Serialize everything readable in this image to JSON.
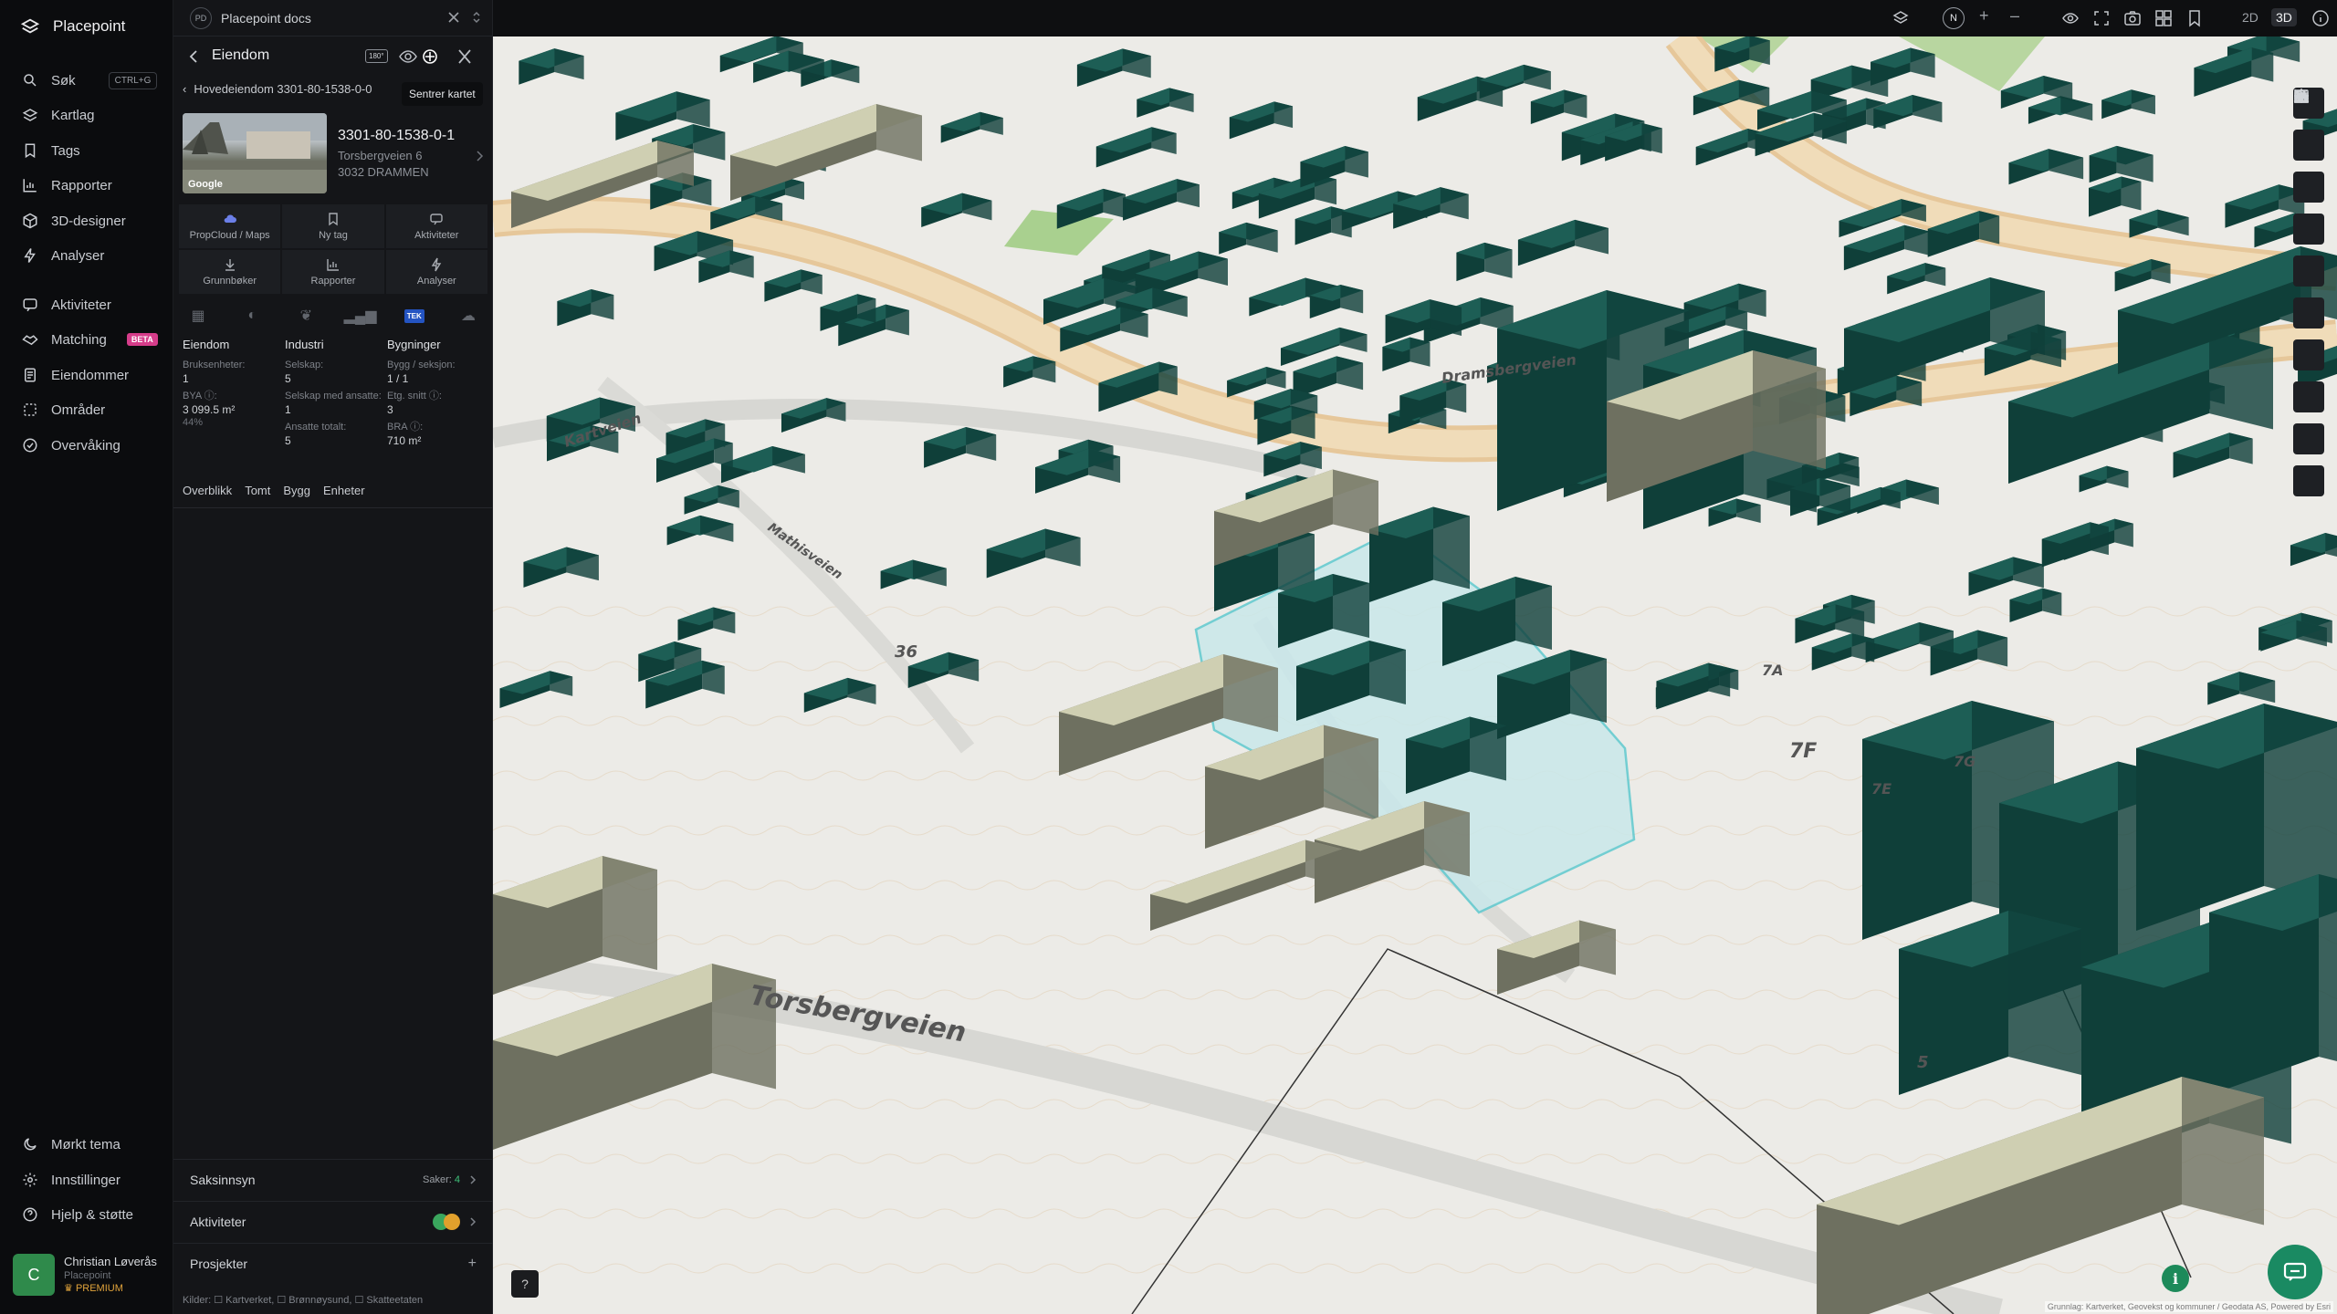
{
  "app": {
    "name": "Placepoint"
  },
  "nav": {
    "search": {
      "label": "Søk",
      "shortcut": "CTRL+G"
    },
    "items_top": [
      "Kartlag",
      "Tags",
      "Rapporter",
      "3D-designer",
      "Analyser"
    ],
    "items_mid": [
      "Aktiviteter",
      "Matching",
      "Eiendommer",
      "Områder",
      "Overvåking"
    ],
    "beta": "BETA",
    "items_bottom": [
      "Mørkt tema",
      "Innstillinger",
      "Hjelp & støtte"
    ]
  },
  "user": {
    "initial": "C",
    "name": "Christian Løverås",
    "org": "Placepoint",
    "plan": "PREMIUM"
  },
  "doc_tab": {
    "badge": "PD",
    "title": "Placepoint docs"
  },
  "panel": {
    "title": "Eiendom",
    "btn_180": "180°",
    "tooltip": "Sentrer kartet",
    "breadcrumb": "Hovedeiendom 3301-80-1538-0-0",
    "photo_credit": "Google",
    "property_id": "3301-80-1538-0-1",
    "address_line1": "Torsbergveien 6",
    "address_line2": "3032 DRAMMEN",
    "actions": [
      "PropCloud / Maps",
      "Ny tag",
      "Aktiviteter",
      "Grunnbøker",
      "Rapporter",
      "Analyser"
    ],
    "tek_badge": "TEK",
    "stats": {
      "eiendom": {
        "heading": "Eiendom",
        "l1": "Bruksenheter:",
        "v1": "1",
        "l2": "BYA ⓘ:",
        "v2": "3 099.5 m²",
        "pct": "44%"
      },
      "industri": {
        "heading": "Industri",
        "l1": "Selskap:",
        "v1": "5",
        "l2": "Selskap med ansatte:",
        "v2": "1",
        "l3": "Ansatte totalt:",
        "v3": "5"
      },
      "bygninger": {
        "heading": "Bygninger",
        "l1": "Bygg / seksjon:",
        "v1": "1 / 1",
        "l2": "Etg. snitt ⓘ:",
        "v2": "3",
        "l3": "BRA ⓘ:",
        "v3": "710 m²"
      }
    },
    "sub_tabs": [
      "Overblikk",
      "Tomt",
      "Bygg",
      "Enheter"
    ],
    "accordion": {
      "saksinnsyn": {
        "label": "Saksinnsyn",
        "meta": "Saker:",
        "count": "4"
      },
      "aktiviteter": {
        "label": "Aktiviteter"
      },
      "prosjekter": {
        "label": "Prosjekter",
        "action": "+"
      }
    },
    "sources": "Kilder: ☐ Kartverket, ☐ Brønnøysund, ☐ Skatteetaten"
  },
  "topbar": {
    "compass": "N",
    "zoom_in": "+",
    "zoom_out": "–",
    "mode_2d": "2D",
    "mode_3d": "3D"
  },
  "map": {
    "labels": {
      "road_main": "Torsbergveien",
      "road_side": "Kartveien",
      "road_a": "Dramsbergveien",
      "road_b": "Mathisveien",
      "num_36": "36",
      "num_7f": "7F",
      "num_7a": "7A",
      "num_7e": "7E",
      "num_7g": "7G",
      "num_5": "5"
    },
    "help": "?",
    "info": "i",
    "attribution": "Grunnlag: Kartverket, Geovekst og kommuner / Geodata AS, Powered by Esri"
  },
  "colors": {
    "building": "#1d5e55",
    "building_dark": "#0f3f39",
    "highlight": "#5ec9cf",
    "accent": "#3ec27a"
  }
}
